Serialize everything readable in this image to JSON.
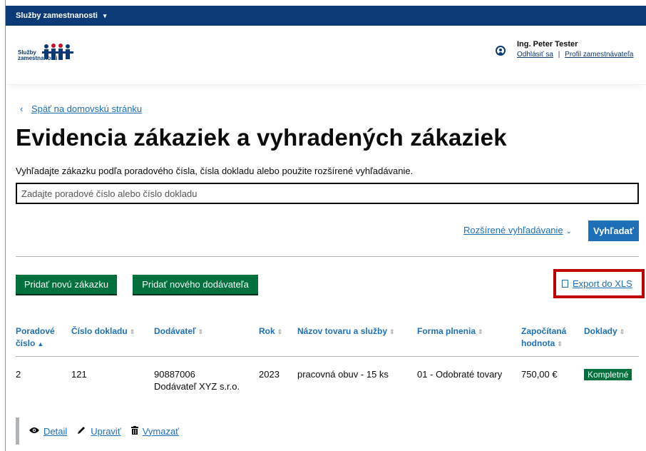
{
  "topbar": {
    "menu_label": "Služby zamestnanosti",
    "caret": "▾"
  },
  "header": {
    "logo_text_line1": "Služby",
    "logo_text_line2": "zamestnanosti",
    "user_name": "Ing. Peter Tester",
    "logout_label": "Odhlásiť sa",
    "separator": "|",
    "employer_profile_label": "Profil zamestnávateľa"
  },
  "nav": {
    "back_arrow": "‹",
    "back_label": "Späť na domovskú stránku"
  },
  "page": {
    "title": "Evidencia zákaziek a vyhradených zákaziek",
    "description": "Vyhľadajte zákazku podľa poradového čísla, čísla dokladu alebo použite rozšírené vyhľadávanie."
  },
  "search": {
    "placeholder": "Zadajte poradové číslo alebo číslo dokladu",
    "value": "",
    "advanced_label": "Rozšírené vyhľadávanie",
    "advanced_chevron": "⌄",
    "submit_label": "Vyhľadať"
  },
  "toolbar": {
    "add_order_label": "Pridať novú zákazku",
    "add_supplier_label": "Pridať nového dodávateľa",
    "export_label": "Export do XLS"
  },
  "table": {
    "columns": [
      {
        "line1": "Poradové",
        "line2": "číslo",
        "sort": "▲"
      },
      {
        "line1": "Číslo dokladu",
        "line2": "",
        "sort": "⇕"
      },
      {
        "line1": "Dodávateľ",
        "line2": "",
        "sort": "⇕"
      },
      {
        "line1": "Rok",
        "line2": "",
        "sort": "⇕"
      },
      {
        "line1": "Názov tovaru a služby",
        "line2": "",
        "sort": "⇕"
      },
      {
        "line1": "Forma plnenia",
        "line2": "",
        "sort": "⇕"
      },
      {
        "line1": "Započítaná",
        "line2": "hodnota",
        "sort": "⇕"
      },
      {
        "line1": "Doklady",
        "line2": "",
        "sort": "⇕"
      }
    ],
    "rows": [
      {
        "order_no": "2",
        "document_no": "121",
        "supplier_id": "90887006",
        "supplier_name": "Dodávateľ XYZ s.r.o.",
        "year": "2023",
        "goods_name": "pracovná obuv - 15 ks",
        "fulfillment_form": "01 - Odobraté tovary",
        "counted_value": "750,00 €",
        "documents_status": "Kompletné"
      }
    ]
  },
  "row_actions": {
    "detail_label": "Detail",
    "edit_label": "Upraviť",
    "delete_label": "Vymazať"
  },
  "colors": {
    "topbar": "#0b3a77",
    "link": "#1d70b8",
    "primary_button": "#1d70b8",
    "green_button": "#00703c",
    "highlight_box": "#c00000"
  }
}
